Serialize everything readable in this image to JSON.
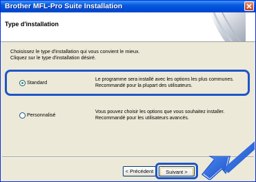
{
  "window": {
    "title": "Brother MFL-Pro Suite Installation"
  },
  "header": {
    "title": "Type d'installation"
  },
  "intro": {
    "line1": "Choisissez le type d'installation qui vous convient le mieux.",
    "line2": "Cliquez sur le type d'installation désiré."
  },
  "options": [
    {
      "label": "Standard",
      "selected": true,
      "desc_line1": "Le programme sera installé avec les options les plus communes.",
      "desc_line2": "Recommandé pour la plupart des utilisateurs."
    },
    {
      "label": "Personnalisé",
      "selected": false,
      "desc_line1": "Vous pouvez choisir les options que vous souhaitez installer.",
      "desc_line2": "Recommandé pour les utilisateurs avancés."
    }
  ],
  "buttons": {
    "back": "< Précédent",
    "next": "Suivant >"
  },
  "colors": {
    "title_bar": "#0A5FD8",
    "highlight": "#1E55C8",
    "dialog_bg": "#ECE9D8"
  },
  "icons": {
    "close": "close-icon",
    "header_graphic": "installer-graphic",
    "pointer_arrow": "arrow-pointer-icon"
  }
}
